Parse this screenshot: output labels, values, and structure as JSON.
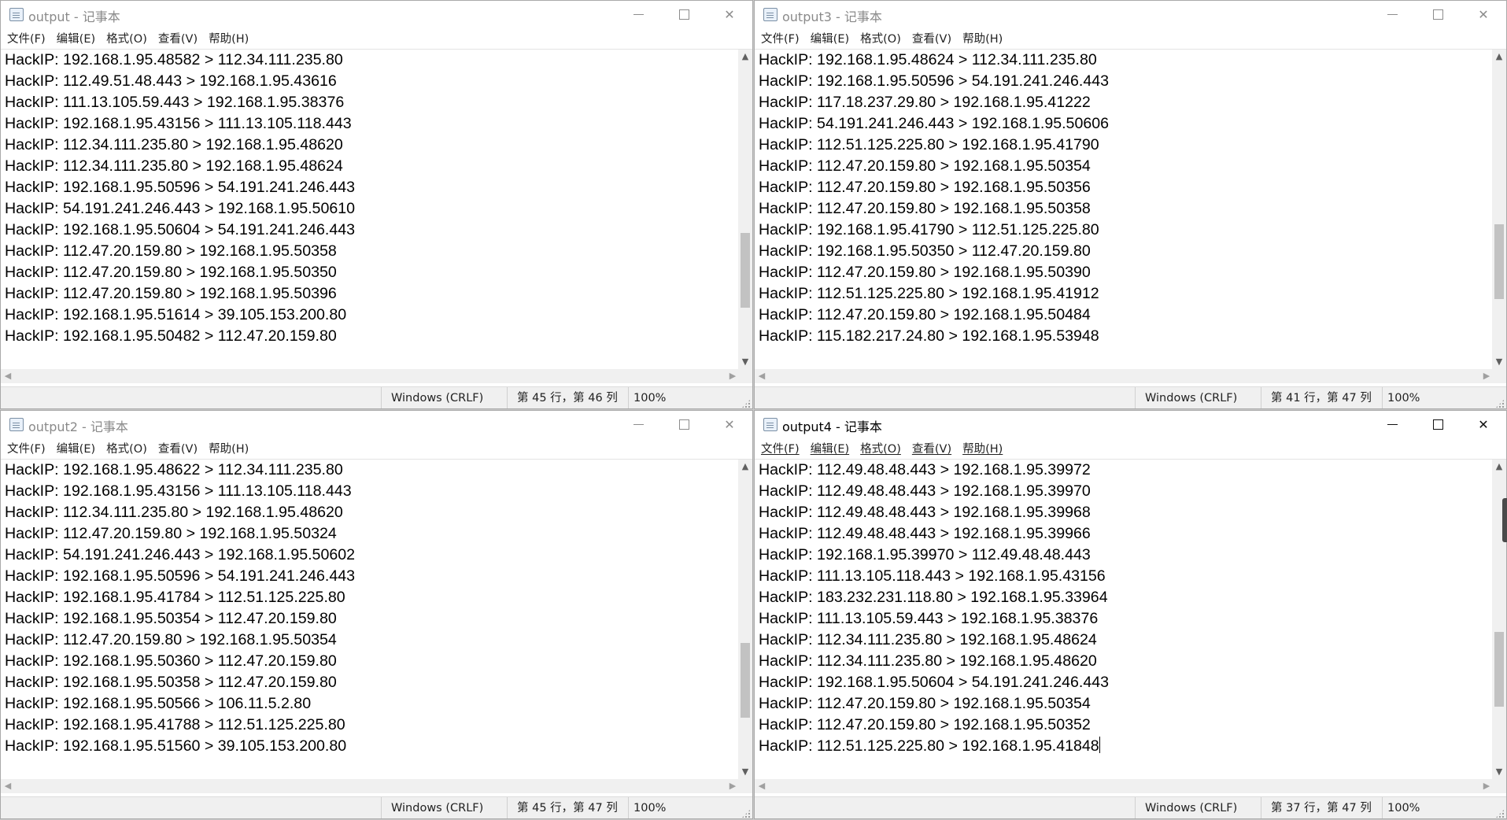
{
  "menu": [
    "文件(F)",
    "编辑(E)",
    "格式(O)",
    "查看(V)",
    "帮助(H)"
  ],
  "windows": [
    {
      "title": "output - 记事本",
      "active": false,
      "lines": [
        "HackIP: 192.168.1.95.48582 > 112.34.111.235.80",
        "HackIP: 112.49.51.48.443 > 192.168.1.95.43616",
        "HackIP: 111.13.105.59.443 > 192.168.1.95.38376",
        "HackIP: 192.168.1.95.43156 > 111.13.105.118.443",
        "HackIP: 112.34.111.235.80 > 192.168.1.95.48620",
        "HackIP: 112.34.111.235.80 > 192.168.1.95.48624",
        "HackIP: 192.168.1.95.50596 > 54.191.241.246.443",
        "HackIP: 54.191.241.246.443 > 192.168.1.95.50610",
        "HackIP: 192.168.1.95.50604 > 54.191.241.246.443",
        "HackIP: 112.47.20.159.80 > 192.168.1.95.50358",
        "HackIP: 112.47.20.159.80 > 192.168.1.95.50350",
        "HackIP: 112.47.20.159.80 > 192.168.1.95.50396",
        "HackIP: 192.168.1.95.51614 > 39.105.153.200.80",
        "HackIP: 192.168.1.95.50482 > 112.47.20.159.80"
      ],
      "status": {
        "encoding": "Windows (CRLF)",
        "position": "第 45 行，第 46 列",
        "zoom": "100%"
      },
      "scroll_position": 0.78
    },
    {
      "title": "output3 - 记事本",
      "active": false,
      "lines": [
        "HackIP: 192.168.1.95.48624 > 112.34.111.235.80",
        "HackIP: 192.168.1.95.50596 > 54.191.241.246.443",
        "HackIP: 117.18.237.29.80 > 192.168.1.95.41222",
        "HackIP: 54.191.241.246.443 > 192.168.1.95.50606",
        "HackIP: 112.51.125.225.80 > 192.168.1.95.41790",
        "HackIP: 112.47.20.159.80 > 192.168.1.95.50354",
        "HackIP: 112.47.20.159.80 > 192.168.1.95.50356",
        "HackIP: 112.47.20.159.80 > 192.168.1.95.50358",
        "HackIP: 192.168.1.95.41790 > 112.51.125.225.80",
        "HackIP: 192.168.1.95.50350 > 112.47.20.159.80",
        "HackIP: 112.47.20.159.80 > 192.168.1.95.50390",
        "HackIP: 112.51.125.225.80 > 192.168.1.95.41912",
        "HackIP: 112.47.20.159.80 > 192.168.1.95.50484",
        "HackIP: 115.182.217.24.80 > 192.168.1.95.53948"
      ],
      "status": {
        "encoding": "Windows (CRLF)",
        "position": "第 41 行，第 47 列",
        "zoom": "100%"
      },
      "scroll_position": 0.74
    },
    {
      "title": "output2 - 记事本",
      "active": false,
      "lines": [
        "HackIP: 192.168.1.95.48622 > 112.34.111.235.80",
        "HackIP: 192.168.1.95.43156 > 111.13.105.118.443",
        "HackIP: 112.34.111.235.80 > 192.168.1.95.48620",
        "HackIP: 112.47.20.159.80 > 192.168.1.95.50324",
        "HackIP: 54.191.241.246.443 > 192.168.1.95.50602",
        "HackIP: 192.168.1.95.50596 > 54.191.241.246.443",
        "HackIP: 192.168.1.95.41784 > 112.51.125.225.80",
        "HackIP: 192.168.1.95.50354 > 112.47.20.159.80",
        "HackIP: 112.47.20.159.80 > 192.168.1.95.50354",
        "HackIP: 192.168.1.95.50360 > 112.47.20.159.80",
        "HackIP: 192.168.1.95.50358 > 112.47.20.159.80",
        "HackIP: 192.168.1.95.50566 > 106.11.5.2.80",
        "HackIP: 192.168.1.95.41788 > 112.51.125.225.80",
        "HackIP: 192.168.1.95.51560 > 39.105.153.200.80"
      ],
      "status": {
        "encoding": "Windows (CRLF)",
        "position": "第 45 行，第 47 列",
        "zoom": "100%"
      },
      "scroll_position": 0.78
    },
    {
      "title": "output4 - 记事本",
      "active": true,
      "lines": [
        "HackIP: 112.49.48.48.443 > 192.168.1.95.39972",
        "HackIP: 112.49.48.48.443 > 192.168.1.95.39970",
        "HackIP: 112.49.48.48.443 > 192.168.1.95.39968",
        "HackIP: 112.49.48.48.443 > 192.168.1.95.39966",
        "HackIP: 192.168.1.95.39970 > 112.49.48.48.443",
        "HackIP: 111.13.105.118.443 > 192.168.1.95.43156",
        "HackIP: 183.232.231.118.80 > 192.168.1.95.33964",
        "HackIP: 111.13.105.59.443 > 192.168.1.95.38376",
        "HackIP: 112.34.111.235.80 > 192.168.1.95.48624",
        "HackIP: 112.34.111.235.80 > 192.168.1.95.48620",
        "HackIP: 192.168.1.95.50604 > 54.191.241.246.443",
        "HackIP: 112.47.20.159.80 > 192.168.1.95.50354",
        "HackIP: 112.47.20.159.80 > 192.168.1.95.50352",
        "HackIP: 112.51.125.225.80 > 192.168.1.95.41848"
      ],
      "status": {
        "encoding": "Windows (CRLF)",
        "position": "第 37 行，第 47 列",
        "zoom": "100%"
      },
      "scroll_position": 0.73
    }
  ],
  "icons": {
    "app": "notepad-icon",
    "minimize": "minimize-icon",
    "maximize": "maximize-icon",
    "close": "close-icon"
  },
  "colors": {
    "inactive_title": "#8a8a8a",
    "active_title": "#000000",
    "scroll_thumb": "#c2c2c2"
  }
}
